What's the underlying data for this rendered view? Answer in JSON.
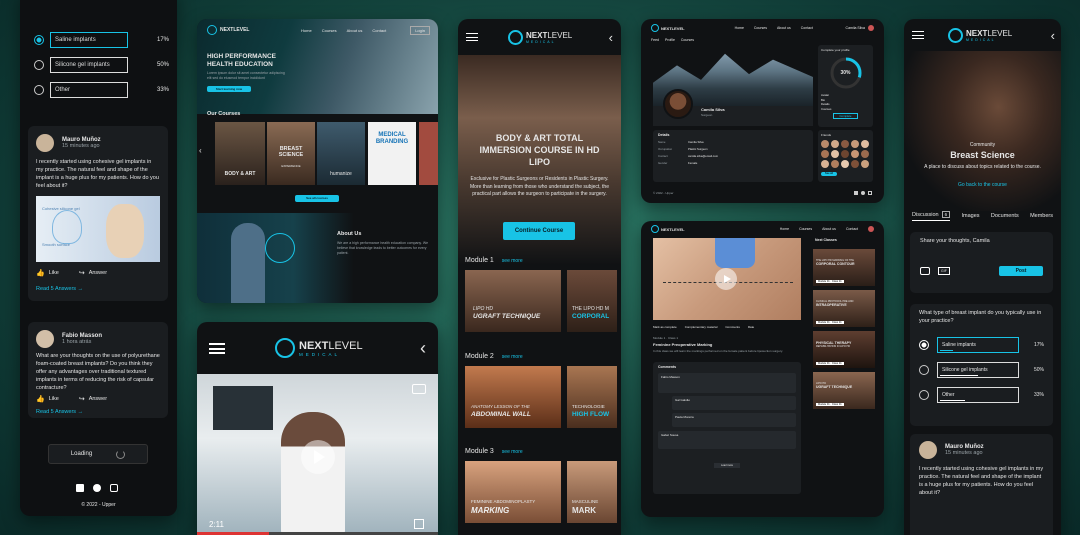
{
  "brand": {
    "name_a": "NEXT",
    "name_b": "LEVEL",
    "sub": "MEDICAL"
  },
  "poll": {
    "question": "What type of breast implant do you typically use in your practice?",
    "options": [
      {
        "label": "Saline implants",
        "pct": "17%",
        "fill": 0.17
      },
      {
        "label": "Silicone gel implants",
        "pct": "50%",
        "fill": 0.5
      },
      {
        "label": "Other",
        "pct": "33%",
        "fill": 0.33
      }
    ]
  },
  "post1": {
    "author": "Mauro Muñoz",
    "time": "15 minutes ago",
    "text": "I recently started using cohesive gel implants in my practice. The natural feel and shape of the implant is a huge plus for my patients. How do you feel about it?",
    "image_labels": [
      "Cohesive silicone gel",
      "Smooth surface"
    ],
    "like": "Like",
    "answer": "Answer",
    "answers": "Read 5 Answers →"
  },
  "post2": {
    "author": "Fabio Masson",
    "time": "1 hora atrás",
    "text": "What are your thoughts on the use of polyurethane foam-coated breast implants? Do you think they offer any advantages over traditional textured implants in terms of reducing the risk of capsular contracture?",
    "like": "Like",
    "answer": "Answer",
    "answers": "Read 5 Answers →"
  },
  "loading": "Loading",
  "copyright": "© 2022 - Upper",
  "desktop_home": {
    "nav": [
      "Home",
      "Courses",
      "About us",
      "Contact"
    ],
    "login": "Login",
    "hero_title": "HIGH PERFORMANCE HEALTH EDUCATION",
    "hero_text": "Lorem ipsum dolor sit amet consectetur adipiscing elit sed do eiusmod tempor incididunt",
    "hero_btn": "Start learning now",
    "our_courses": "Our Courses",
    "courses": [
      "BODY & ART",
      "BREAST SCIENCE",
      "humanize",
      "MEDICAL BRANDING"
    ],
    "course_sub": [
      "",
      "EXPERIENCE",
      "",
      ""
    ],
    "see_all": "See all courses",
    "about_title": "About Us",
    "about_text": "We are a high performance health education company. We believe that knowledge leads to better outcomes for every patient."
  },
  "mobile_course": {
    "title": "BODY & ART TOTAL IMMERSION COURSE IN HD LIPO",
    "desc": "Exclusive for Plastic Surgeons or Residents in Plastic Surgery. More than learning from those who understand the subject, the practical part allows the surgeon to participate in the surgery.",
    "cta": "Continue Course",
    "modules": [
      {
        "name": "Module 1",
        "see": "see more",
        "cards": [
          [
            "LIPO HD",
            "UGRAFT TECHNIQUE"
          ],
          [
            "THE LIPO HD M",
            "CORPORAL"
          ]
        ]
      },
      {
        "name": "Module 2",
        "see": "see more",
        "cards": [
          [
            "ANATOMY LESSON OF THE",
            "ABDOMINAL WALL"
          ],
          [
            "TECHNOLOGIE",
            "HIGH FLOW"
          ]
        ]
      },
      {
        "name": "Module 3",
        "see": "see more",
        "cards": [
          [
            "FEMININE ABDOMINOPLASTY",
            "MARKING"
          ],
          [
            "MASCULINE",
            "MARK"
          ]
        ]
      }
    ]
  },
  "mobile_video": {
    "time": "2:11"
  },
  "profile": {
    "nav": [
      "Home",
      "Courses",
      "About us",
      "Contact"
    ],
    "user": "Camila Silva",
    "role": "Surgeon",
    "tabs": [
      "Feed",
      "Profile",
      "Courses"
    ],
    "complete_title": "Complete your profile",
    "complete_pct": "30%",
    "complete_items": [
      "Avatar",
      "Bio",
      "Details",
      "Courses",
      "Friends"
    ],
    "complete_btn": "Complete",
    "details_title": "Details",
    "details": [
      [
        "Name",
        "Camila Silva"
      ],
      [
        "Occupation",
        "Plastic Surgeon"
      ],
      [
        "Contact",
        "camila.silva@email.com"
      ],
      [
        "Gender",
        "Female"
      ]
    ],
    "friends_title": "Friends",
    "friends_btn": "See all",
    "footer": "© 2022 - Upper",
    "progress_fill": 0.3
  },
  "lesson": {
    "nav": [
      "Home",
      "Courses",
      "About us",
      "Contact"
    ],
    "next_classes": "Next Classes",
    "classes": [
      [
        "THE LIPO HD MARKING OF THE",
        "CORPORAL CONTOUR"
      ],
      [
        "CLINICAL PROTOCOL PRE AND",
        "INTRAOPERATIVE"
      ],
      [
        "PHYSICAL THERAPY",
        "REHABILITATION IN LIPO HD"
      ],
      [
        "LIPO HD",
        "UGRAFT TECHNIQUE"
      ]
    ],
    "class_meta": "Module 01 · Class 01",
    "actions": [
      "Mark as complete",
      "Complementary material",
      "Comments",
      "Rate"
    ],
    "module": "Module 1 · Class 1",
    "lesson_title": "Feminine Preoperative Marking",
    "lesson_text": "In this class we will learn the markings performed on the female patient before liposuction surgery.",
    "comments": "Comments",
    "commenters": [
      "Fabio Masson",
      "Gal Galvão",
      "Paula Moreira",
      "Isabel Sousa"
    ],
    "more": "Load more"
  },
  "community": {
    "kicker": "Community",
    "title": "Breast Science",
    "desc": "A place to discuss about topics related to the course.",
    "back": "Go back to the course",
    "tabs": [
      "Discussion",
      "Images",
      "Documents",
      "Members"
    ],
    "badge": "6",
    "share": "Share your thoughts, Camila",
    "gif": "GIF",
    "post": "Post"
  },
  "colors": {
    "accent": "#18c3e6",
    "panel": "#101214"
  }
}
